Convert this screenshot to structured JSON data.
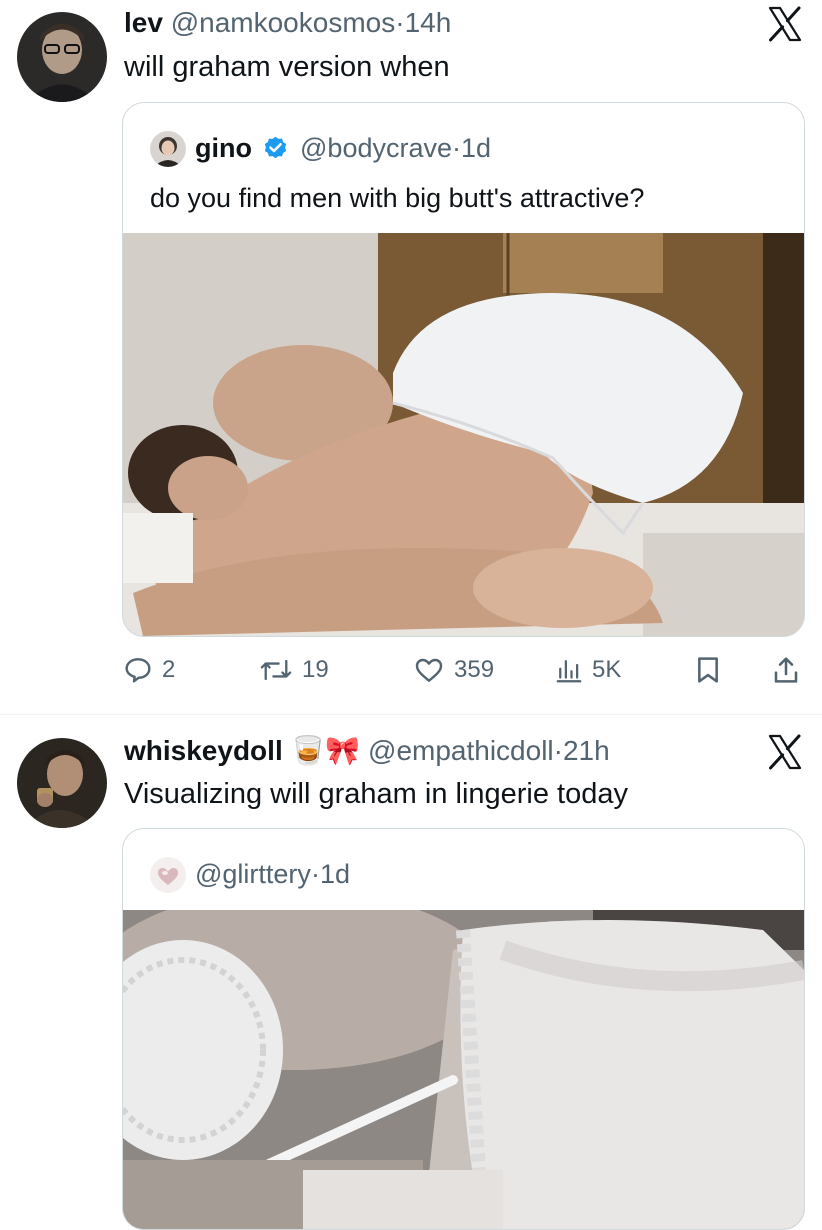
{
  "tweets": [
    {
      "author": {
        "name": "lev",
        "handle": "@namkookosmos",
        "time": "14h",
        "avatar": "avatar-lev"
      },
      "text": "will graham version when",
      "platform_icon": "x-logo-icon",
      "quote": {
        "author": {
          "name": "gino",
          "verified": true,
          "handle": "@bodycrave",
          "time": "1d"
        },
        "text": "do you find men with big butt's attractive?",
        "media": "photo"
      },
      "actions": {
        "replies": "2",
        "reposts": "19",
        "likes": "359",
        "views": "5K",
        "icons": [
          "reply-icon",
          "repost-icon",
          "like-icon",
          "views-icon",
          "bookmark-icon",
          "share-icon"
        ]
      }
    },
    {
      "author": {
        "name": "whiskeydoll",
        "emoji": "🥃🎀",
        "handle": "@empathicdoll",
        "time": "21h",
        "avatar": "avatar-whiskeydoll"
      },
      "text": "Visualizing will graham in lingerie today",
      "platform_icon": "x-logo-icon",
      "quote": {
        "author": {
          "handle": "@glirttery",
          "time": "1d"
        },
        "media": "photo"
      }
    }
  ],
  "separator": "·",
  "colors": {
    "text": "#0f1419",
    "secondary": "#536471",
    "border": "#cfd9de",
    "verified": "#1d9bf0"
  }
}
